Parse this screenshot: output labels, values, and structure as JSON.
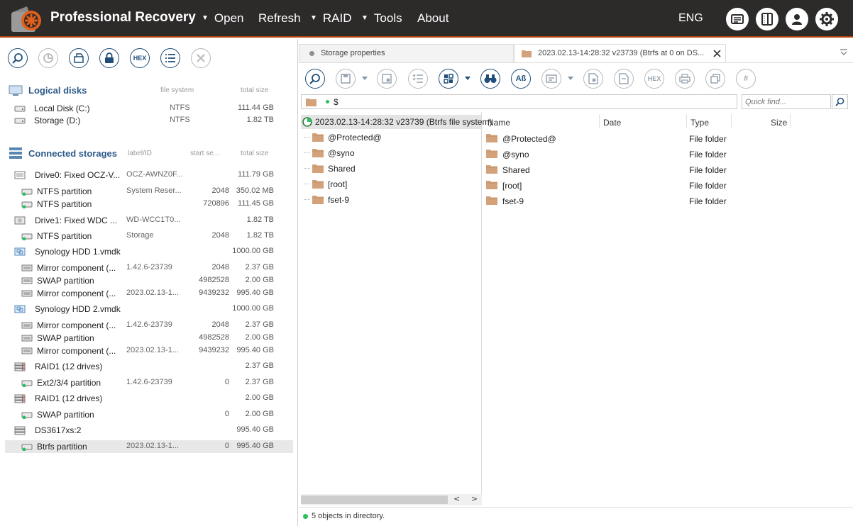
{
  "app": {
    "title": "Professional Recovery",
    "lang": "ENG"
  },
  "menu": [
    {
      "label": "Open",
      "caret": true
    },
    {
      "label": "Refresh",
      "caret": false
    },
    {
      "label": "RAID",
      "caret": true
    },
    {
      "label": "Tools",
      "caret": true
    },
    {
      "label": "About",
      "caret": false
    }
  ],
  "topbar_icons": [
    "log-icon",
    "panel-icon",
    "account-icon",
    "settings-icon"
  ],
  "left_toolbar": [
    {
      "icon": "scan-icon",
      "enabled": true
    },
    {
      "icon": "chart-icon",
      "enabled": false
    },
    {
      "icon": "open-image-icon",
      "enabled": true
    },
    {
      "icon": "lock-icon",
      "enabled": true
    },
    {
      "icon": "hex-icon",
      "label": "HEX",
      "enabled": true
    },
    {
      "icon": "list-icon",
      "enabled": true
    },
    {
      "icon": "close-icon",
      "enabled": false
    }
  ],
  "logical": {
    "title": "Logical disks",
    "col_fs": "file system",
    "col_size": "total size",
    "items": [
      {
        "name": "Local Disk (C:)",
        "fs": "NTFS",
        "size": "111.44 GB"
      },
      {
        "name": "Storage (D:)",
        "fs": "NTFS",
        "size": "1.82 TB"
      }
    ]
  },
  "connected": {
    "title": "Connected storages",
    "col_label": "label/ID",
    "col_start": "start se...",
    "col_size": "total size",
    "items": [
      {
        "name": "Drive0: Fixed OCZ-V...",
        "label": "OCZ-AWNZ0F...",
        "start": "",
        "size": "111.79 GB",
        "indent": 0,
        "icon": "drive-icon",
        "selected": false
      },
      {
        "name": "NTFS partition",
        "label": "System Reser...",
        "start": "2048",
        "size": "350.02 MB",
        "indent": 1,
        "icon": "partition-icon",
        "selected": false
      },
      {
        "name": "NTFS partition",
        "label": "",
        "start": "720896",
        "size": "111.45 GB",
        "indent": 1,
        "icon": "partition-icon",
        "selected": false
      },
      {
        "name": "Drive1: Fixed WDC ...",
        "label": "WD-WCC1T0...",
        "start": "",
        "size": "1.82 TB",
        "indent": 0,
        "icon": "hdd-icon",
        "selected": false
      },
      {
        "name": "NTFS partition",
        "label": "Storage",
        "start": "2048",
        "size": "1.82 TB",
        "indent": 1,
        "icon": "partition-icon",
        "selected": false
      },
      {
        "name": "Synology HDD 1.vmdk",
        "label": "",
        "start": "",
        "size": "1000.00 GB",
        "indent": 0,
        "icon": "vmdk-icon",
        "selected": false
      },
      {
        "name": "Mirror component (...",
        "label": "1.42.6-23739",
        "start": "2048",
        "size": "2.37 GB",
        "indent": 1,
        "icon": "raid-component-icon",
        "selected": false
      },
      {
        "name": "SWAP partition",
        "label": "",
        "start": "4982528",
        "size": "2.00 GB",
        "indent": 1,
        "icon": "raid-component-icon",
        "selected": false
      },
      {
        "name": "Mirror component (...",
        "label": "2023.02.13-1...",
        "start": "9439232",
        "size": "995.40 GB",
        "indent": 1,
        "icon": "raid-component-icon",
        "selected": false
      },
      {
        "name": "Synology HDD 2.vmdk",
        "label": "",
        "start": "",
        "size": "1000.00 GB",
        "indent": 0,
        "icon": "vmdk-icon",
        "selected": false
      },
      {
        "name": "Mirror component (...",
        "label": "1.42.6-23739",
        "start": "2048",
        "size": "2.37 GB",
        "indent": 1,
        "icon": "raid-component-icon",
        "selected": false
      },
      {
        "name": "SWAP partition",
        "label": "",
        "start": "4982528",
        "size": "2.00 GB",
        "indent": 1,
        "icon": "raid-component-icon",
        "selected": false
      },
      {
        "name": "Mirror component (...",
        "label": "2023.02.13-1...",
        "start": "9439232",
        "size": "995.40 GB",
        "indent": 1,
        "icon": "raid-component-icon",
        "selected": false
      },
      {
        "name": "RAID1 (12 drives)",
        "label": "",
        "start": "",
        "size": "2.37 GB",
        "indent": 0,
        "icon": "raid-icon",
        "selected": false
      },
      {
        "name": "Ext2/3/4 partition",
        "label": "1.42.6-23739",
        "start": "0",
        "size": "2.37 GB",
        "indent": 1,
        "icon": "partition-icon",
        "selected": false
      },
      {
        "name": "RAID1 (12 drives)",
        "label": "",
        "start": "",
        "size": "2.00 GB",
        "indent": 0,
        "icon": "raid-icon",
        "selected": false
      },
      {
        "name": "SWAP partition",
        "label": "",
        "start": "0",
        "size": "2.00 GB",
        "indent": 1,
        "icon": "partition-icon",
        "selected": false
      },
      {
        "name": "DS3617xs:2",
        "label": "",
        "start": "",
        "size": "995.40 GB",
        "indent": 0,
        "icon": "volume-icon",
        "selected": false
      },
      {
        "name": "Btrfs partition",
        "label": "2023.02.13-1...",
        "start": "0",
        "size": "995.40 GB",
        "indent": 1,
        "icon": "partition-icon",
        "selected": true
      }
    ]
  },
  "tabs": [
    {
      "label": "Storage properties",
      "active": false
    },
    {
      "label": "2023.02.13-14:28:32 v23739 (Btrfs at 0 on DS...",
      "active": true
    }
  ],
  "right_toolbar": [
    {
      "icon": "scan-icon",
      "enabled": true,
      "dropdown": false
    },
    {
      "icon": "save-icon",
      "enabled": false,
      "dropdown": true
    },
    {
      "icon": "file-settings-icon",
      "enabled": false,
      "dropdown": false
    },
    {
      "icon": "checklist-icon",
      "enabled": false,
      "dropdown": false
    },
    {
      "icon": "view-mode-icon",
      "enabled": true,
      "dropdown": true
    },
    {
      "icon": "binoculars-icon",
      "enabled": true,
      "dropdown": false
    },
    {
      "icon": "case-icon",
      "label": "Aß",
      "enabled": true,
      "dropdown": false
    },
    {
      "icon": "preview-icon",
      "enabled": false,
      "dropdown": true
    },
    {
      "icon": "file-gear-icon",
      "enabled": false,
      "dropdown": false
    },
    {
      "icon": "file-open-icon",
      "enabled": false,
      "dropdown": false
    },
    {
      "icon": "hex-icon",
      "label": "HEX",
      "enabled": false,
      "dropdown": false
    },
    {
      "icon": "print-icon",
      "enabled": false,
      "dropdown": false
    },
    {
      "icon": "copy-icon",
      "enabled": false,
      "dropdown": false
    },
    {
      "icon": "hash-icon",
      "label": "#",
      "enabled": false,
      "dropdown": false
    }
  ],
  "path": {
    "value": "$",
    "quick_placeholder": "Quick find..."
  },
  "tree": {
    "root": "2023.02.13-14:28:32 v23739 (Btrfs file system)",
    "children": [
      "@Protected@",
      "@syno",
      "Shared",
      "[root]",
      "fset-9"
    ]
  },
  "list": {
    "columns": [
      "Name",
      "Date",
      "Type",
      "Size"
    ],
    "rows": [
      {
        "name": "@Protected@",
        "date": "",
        "type": "File folder",
        "size": ""
      },
      {
        "name": "@syno",
        "date": "",
        "type": "File folder",
        "size": ""
      },
      {
        "name": "Shared",
        "date": "",
        "type": "File folder",
        "size": ""
      },
      {
        "name": "[root]",
        "date": "",
        "type": "File folder",
        "size": ""
      },
      {
        "name": "fset-9",
        "date": "",
        "type": "File folder",
        "size": ""
      }
    ]
  },
  "status": {
    "text": "5 objects in directory."
  },
  "colors": {
    "topbar": "#2d2a2a",
    "accent": "#b3410b",
    "heading": "#2e5b88",
    "icon": "#1e4e79",
    "folder": "#d3a27a",
    "ok": "#2bbf5d"
  }
}
